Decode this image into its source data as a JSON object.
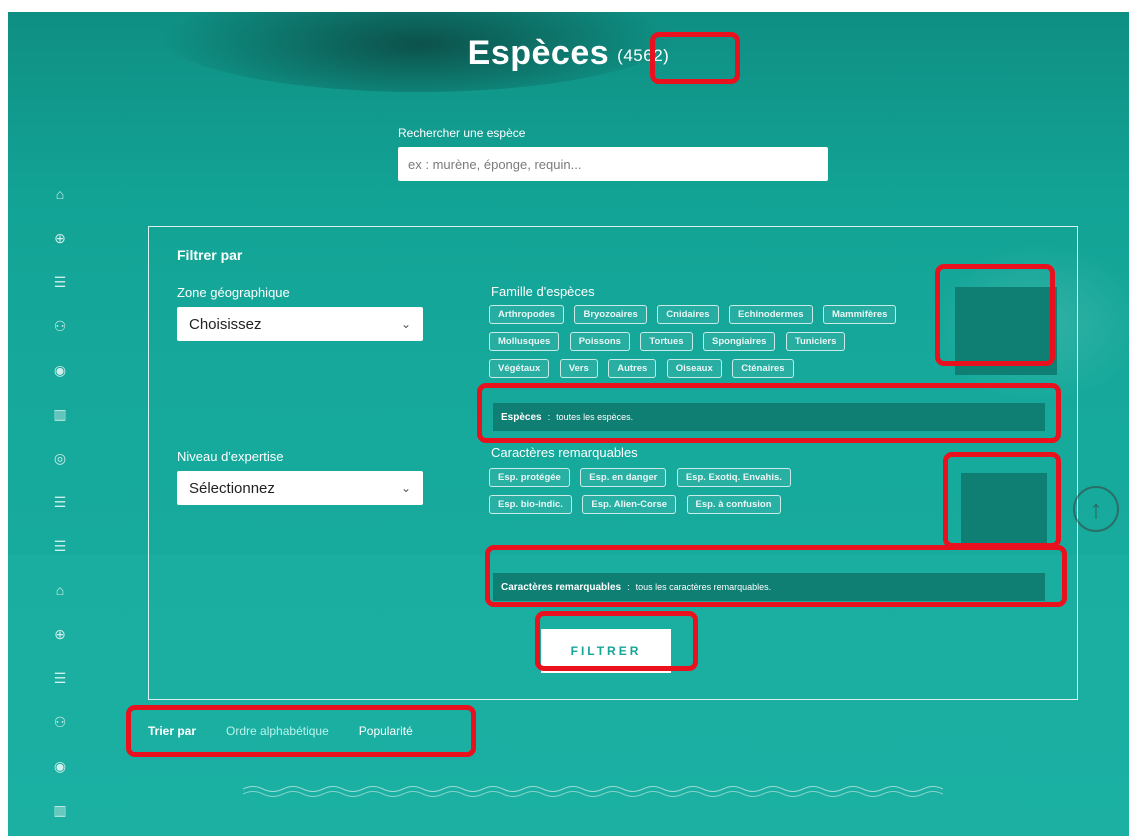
{
  "header": {
    "title": "Espèces",
    "count": "(4562)"
  },
  "search": {
    "label": "Rechercher une espèce",
    "placeholder": "ex : murène, éponge, requin..."
  },
  "sidebar": {
    "icons": [
      "home-icon",
      "plus-circle-icon",
      "list-icon",
      "user-icon",
      "eye-icon",
      "map-icon",
      "location-pin-icon",
      "list-icon",
      "list-icon",
      "home-icon",
      "plus-circle-icon",
      "list-icon",
      "user-icon",
      "eye-icon",
      "map-icon"
    ]
  },
  "filter": {
    "title": "Filtrer par",
    "zone_label": "Zone géographique",
    "zone_value": "Choisissez",
    "level_label": "Niveau d'expertise",
    "level_value": "Sélectionnez",
    "family_label": "Famille d'espèces",
    "families": [
      "Arthropodes",
      "Bryozoaires",
      "Cnidaires",
      "Echinodermes",
      "Mammifères",
      "Mollusques",
      "Poissons",
      "Tortues",
      "Spongiaires",
      "Tuniciers",
      "Végétaux",
      "Vers",
      "Autres",
      "Oiseaux",
      "Cténaires"
    ],
    "species_info_label": "Espèces",
    "species_info_sep": ":",
    "species_info_text": "toutes les espèces.",
    "traits_label": "Caractères remarquables",
    "traits": [
      "Esp. protégée",
      "Esp. en danger",
      "Esp. Exotiq. Envahis.",
      "Esp. bio-indic.",
      "Esp. Alien-Corse",
      "Esp. à confusion"
    ],
    "traits_info_label": "Caractères remarquables",
    "traits_info_sep": ":",
    "traits_info_text": "tous les caractères remarquables.",
    "button_label": "FILTRER"
  },
  "sort": {
    "label": "Trier par",
    "options": [
      "Ordre alphabétique",
      "Popularité"
    ],
    "active": "Ordre alphabétique"
  },
  "colors": {
    "accent": "#14a597",
    "highlight": "#e8111d",
    "dark_bar": "#0f7e73"
  }
}
